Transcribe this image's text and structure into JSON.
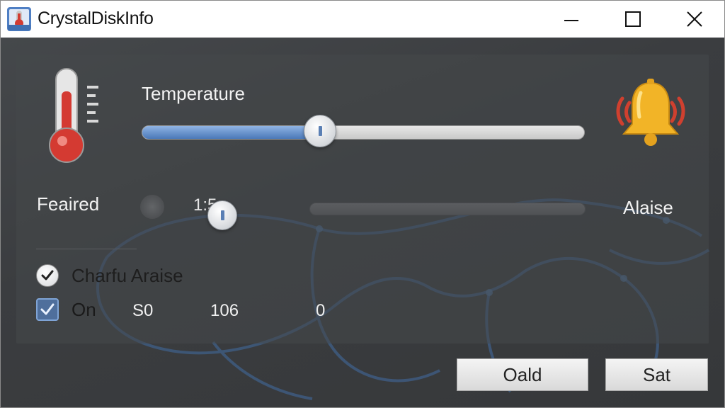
{
  "window": {
    "title": "CrystalDiskInfo"
  },
  "temperature": {
    "label": "Temperature",
    "slider_value_pct": 40
  },
  "feaired": {
    "label": "Feaired",
    "value": "1:5",
    "alert_label": "Alaise"
  },
  "options": [
    {
      "label": "Charfu Araise",
      "checked": true
    },
    {
      "label": "On",
      "checked": true
    }
  ],
  "values": [
    "S0",
    "106",
    "0"
  ],
  "buttons": {
    "oald": "Oald",
    "sat": "Sat"
  },
  "colors": {
    "accent": "#4a78b8",
    "bell": "#f2b427",
    "thermo_red": "#d43a32"
  }
}
